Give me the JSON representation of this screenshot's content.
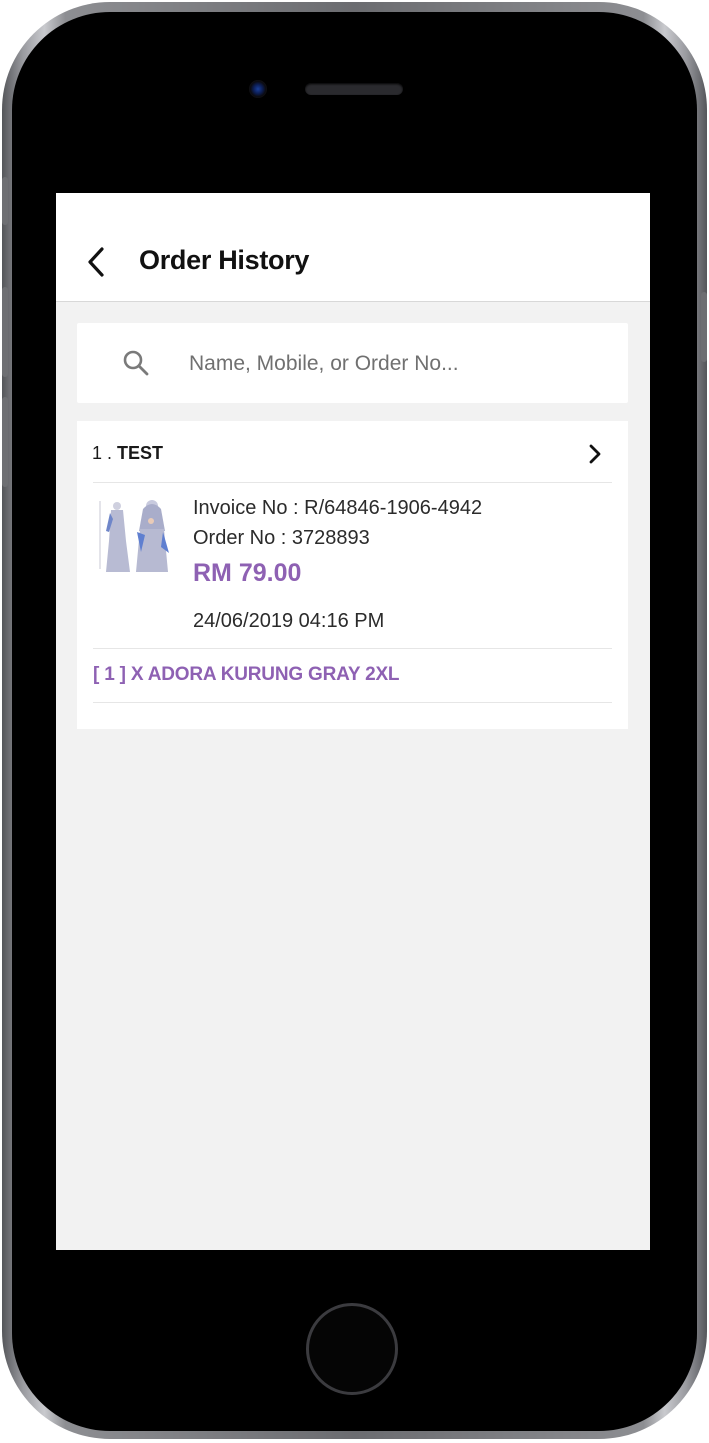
{
  "header": {
    "title": "Order History"
  },
  "search": {
    "placeholder": "Name, Mobile, or Order No..."
  },
  "orders": [
    {
      "index": "1 .",
      "customer_name": "TEST",
      "invoice": "Invoice No : R/64846-1906-4942",
      "order_no": "Order No : 3728893",
      "total": "RM 79.00",
      "datetime": "24/06/2019 04:16 PM",
      "items_summary": "[ 1 ] X ADORA KURUNG GRAY 2XL"
    }
  ],
  "colors": {
    "accent": "#8e61b3",
    "background": "#f2f2f2",
    "card": "#ffffff"
  },
  "icons": {
    "back": "chevron-left-icon",
    "search": "search-icon",
    "open_order": "chevron-right-icon"
  }
}
